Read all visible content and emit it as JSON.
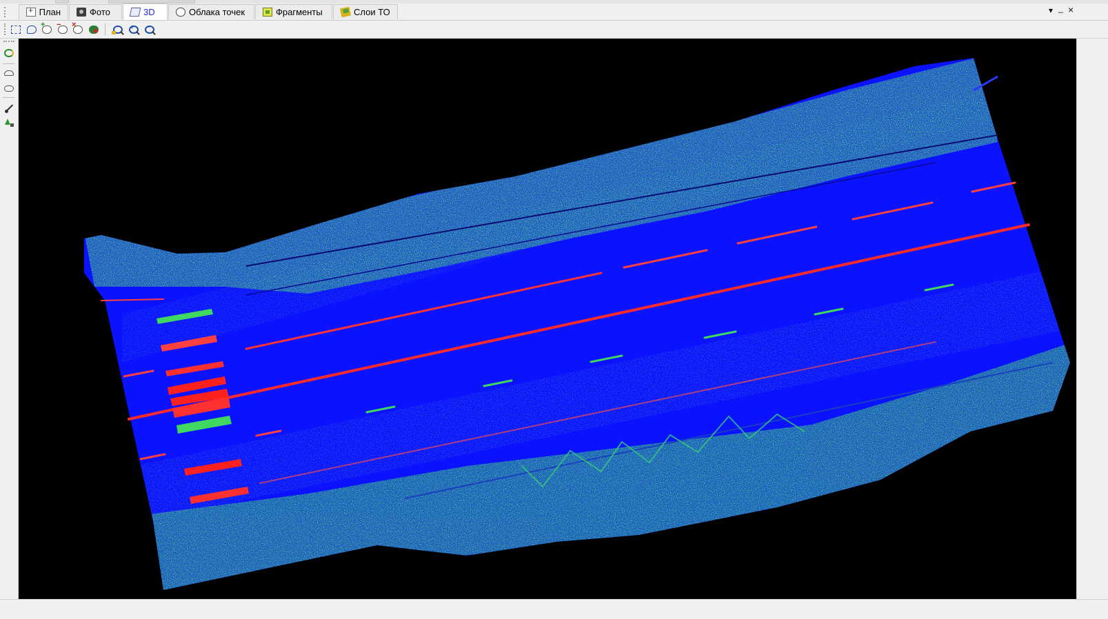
{
  "tabs": [
    {
      "label": "План",
      "icon": "plan-icon"
    },
    {
      "label": "Фото",
      "icon": "camera-icon"
    },
    {
      "label": "3D",
      "icon": "cube-3d-icon",
      "active": true
    },
    {
      "label": "Облака точек",
      "icon": "cloud-icon"
    },
    {
      "label": "Фрагменты",
      "icon": "fragments-icon"
    },
    {
      "label": "Слои ТО",
      "icon": "layers-icon"
    }
  ],
  "window_controls": {
    "menu": "▾",
    "minimize": "_",
    "close": "×"
  },
  "toolbar": {
    "buttons": [
      "rect-select-icon",
      "lasso-select-icon",
      "add-to-cloud-icon",
      "remove-from-cloud-icon",
      "clear-cloud-icon",
      "color-cloud-icon",
      "zoom-fit-icon",
      "zoom-in-icon",
      "zoom-out-icon"
    ]
  },
  "left_tools": [
    "rotate-view-icon",
    "car-view-icon",
    "car-top-view-icon",
    "trajectory-icon",
    "tree-object-icon"
  ],
  "colors": {
    "viewport_bg": "#000000",
    "road": "#0a14ff",
    "vegetation_green": "#2fb84a",
    "marking_red": "#ff2a2a",
    "accent_active_tab": "#2b2bd8"
  }
}
